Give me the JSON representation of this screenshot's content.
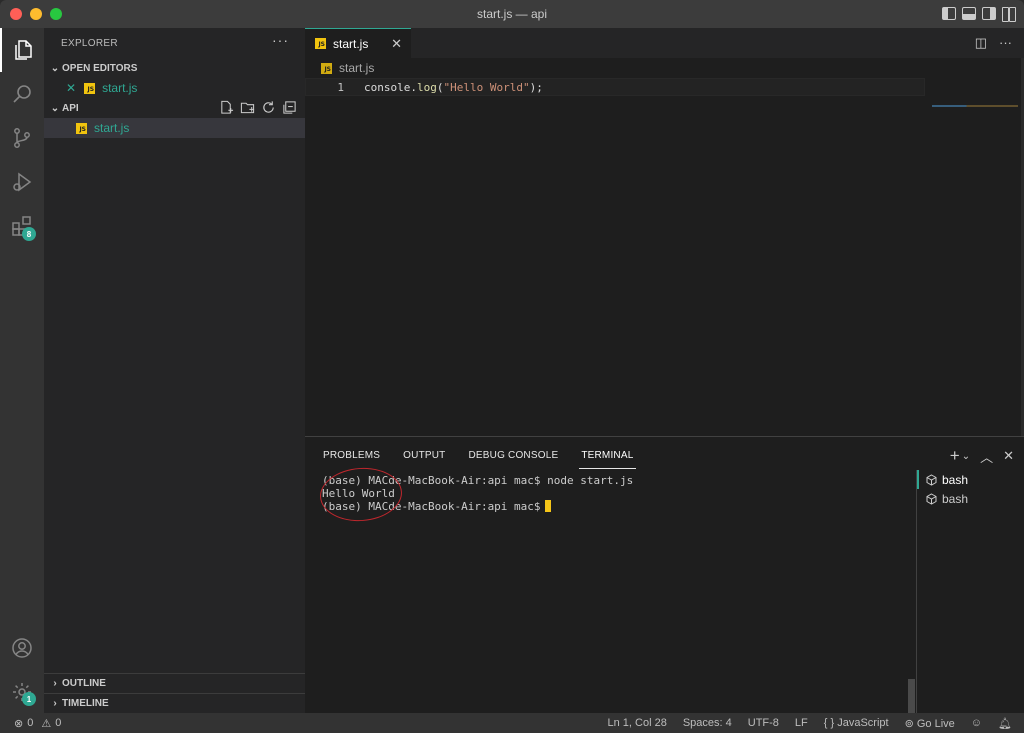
{
  "window": {
    "title": "start.js — api"
  },
  "activity_bar": {
    "extensions_badge": "8",
    "settings_badge": "1"
  },
  "sidebar": {
    "title": "EXPLORER",
    "open_editors_label": "OPEN EDITORS",
    "open_editor_file": "start.js",
    "folder_label": "API",
    "files": [
      "start.js"
    ],
    "outline_label": "OUTLINE",
    "timeline_label": "TIMELINE"
  },
  "editor": {
    "tab_label": "start.js",
    "breadcrumb": "start.js",
    "line_number": "1",
    "code": {
      "object": "console",
      "dot": ".",
      "method": "log",
      "open_paren": "(",
      "string": "\"Hello World\"",
      "close": ");"
    }
  },
  "panel": {
    "tabs": [
      "PROBLEMS",
      "OUTPUT",
      "DEBUG CONSOLE",
      "TERMINAL"
    ],
    "active_tab": "TERMINAL",
    "terminal_lines": [
      "(base) MACde-MacBook-Air:api mac$ node start.js",
      "Hello World",
      "(base) MACde-MacBook-Air:api mac$"
    ],
    "terminals": [
      "bash",
      "bash"
    ]
  },
  "status_bar": {
    "errors": "0",
    "warnings": "0",
    "position": "Ln 1, Col 28",
    "spaces": "Spaces: 4",
    "encoding": "UTF-8",
    "eol": "LF",
    "language": "JavaScript",
    "go_live": "Go Live"
  },
  "colors": {
    "accent": "#2fa893",
    "annotation_circle": "#c0272d",
    "cursor": "#f5c518"
  }
}
